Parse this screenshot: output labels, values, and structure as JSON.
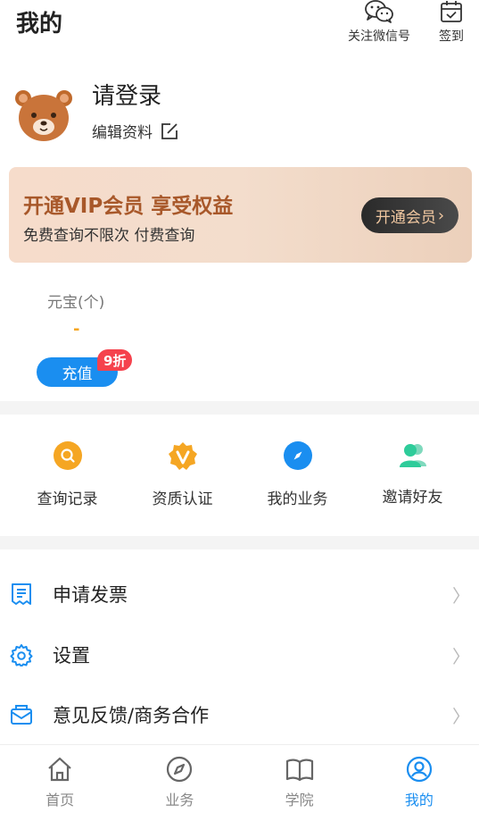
{
  "header": {
    "title": "我的",
    "wechat_label": "关注微信号",
    "signin_label": "签到"
  },
  "profile": {
    "login_text": "请登录",
    "edit_label": "编辑资料"
  },
  "vip": {
    "title": "开通VIP会员 享受权益",
    "subtitle": "免费查询不限次 付费查询",
    "button_label": "开通会员",
    "button_chevron": "〉"
  },
  "balance": {
    "label": "元宝(个)",
    "value": "-",
    "recharge_label": "充值",
    "discount_badge": "9折"
  },
  "grid": [
    {
      "label": "查询记录",
      "icon": "search-record-icon",
      "color": "#f5a623"
    },
    {
      "label": "资质认证",
      "icon": "v-badge-icon",
      "color": "#f5a623"
    },
    {
      "label": "我的业务",
      "icon": "compass-icon",
      "color": "#1a8ef0"
    },
    {
      "label": "邀请好友",
      "icon": "friends-icon",
      "color": "#2ecc9a"
    }
  ],
  "list": [
    {
      "label": "申请发票",
      "icon": "invoice-icon"
    },
    {
      "label": "设置",
      "icon": "gear-icon"
    },
    {
      "label": "意见反馈/商务合作",
      "icon": "mail-icon"
    }
  ],
  "tabs": [
    {
      "label": "首页",
      "icon": "home-icon",
      "active": false
    },
    {
      "label": "业务",
      "icon": "compass-icon",
      "active": false
    },
    {
      "label": "学院",
      "icon": "book-icon",
      "active": false
    },
    {
      "label": "我的",
      "icon": "user-circle-icon",
      "active": true
    }
  ],
  "colors": {
    "accent": "#1a8ef0",
    "vip_title": "#a8582a",
    "vip_button_text": "#f0c7a0",
    "discount_badge": "#f5424d",
    "balance_value": "#f5a623"
  }
}
